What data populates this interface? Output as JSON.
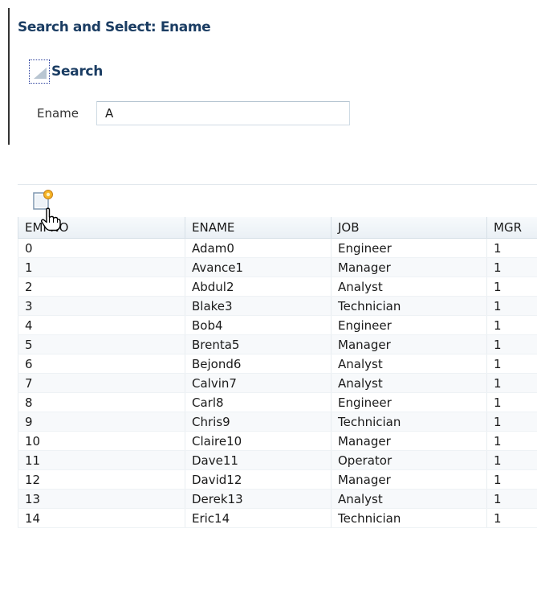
{
  "dialog": {
    "title": "Search and Select: Ename"
  },
  "search": {
    "header_label": "Search",
    "field_label": "Ename",
    "field_value": "A"
  },
  "toolbar": {
    "create_icon": "create-new-row-icon"
  },
  "cursor": {
    "icon": "hand-pointer-icon"
  },
  "table": {
    "columns": [
      "EMPNO",
      "ENAME",
      "JOB",
      "MGR"
    ],
    "rows": [
      [
        "0",
        "Adam0",
        "Engineer",
        "1"
      ],
      [
        "1",
        "Avance1",
        "Manager",
        "1"
      ],
      [
        "2",
        "Abdul2",
        "Analyst",
        "1"
      ],
      [
        "3",
        "Blake3",
        "Technician",
        "1"
      ],
      [
        "4",
        "Bob4",
        "Engineer",
        "1"
      ],
      [
        "5",
        "Brenta5",
        "Manager",
        "1"
      ],
      [
        "6",
        "Bejond6",
        "Analyst",
        "1"
      ],
      [
        "7",
        "Calvin7",
        "Analyst",
        "1"
      ],
      [
        "8",
        "Carl8",
        "Engineer",
        "1"
      ],
      [
        "9",
        "Chris9",
        "Technician",
        "1"
      ],
      [
        "10",
        "Claire10",
        "Manager",
        "1"
      ],
      [
        "11",
        "Dave11",
        "Operator",
        "1"
      ],
      [
        "12",
        "David12",
        "Manager",
        "1"
      ],
      [
        "13",
        "Derek13",
        "Analyst",
        "1"
      ],
      [
        "14",
        "Eric14",
        "Technician",
        "1"
      ]
    ]
  }
}
